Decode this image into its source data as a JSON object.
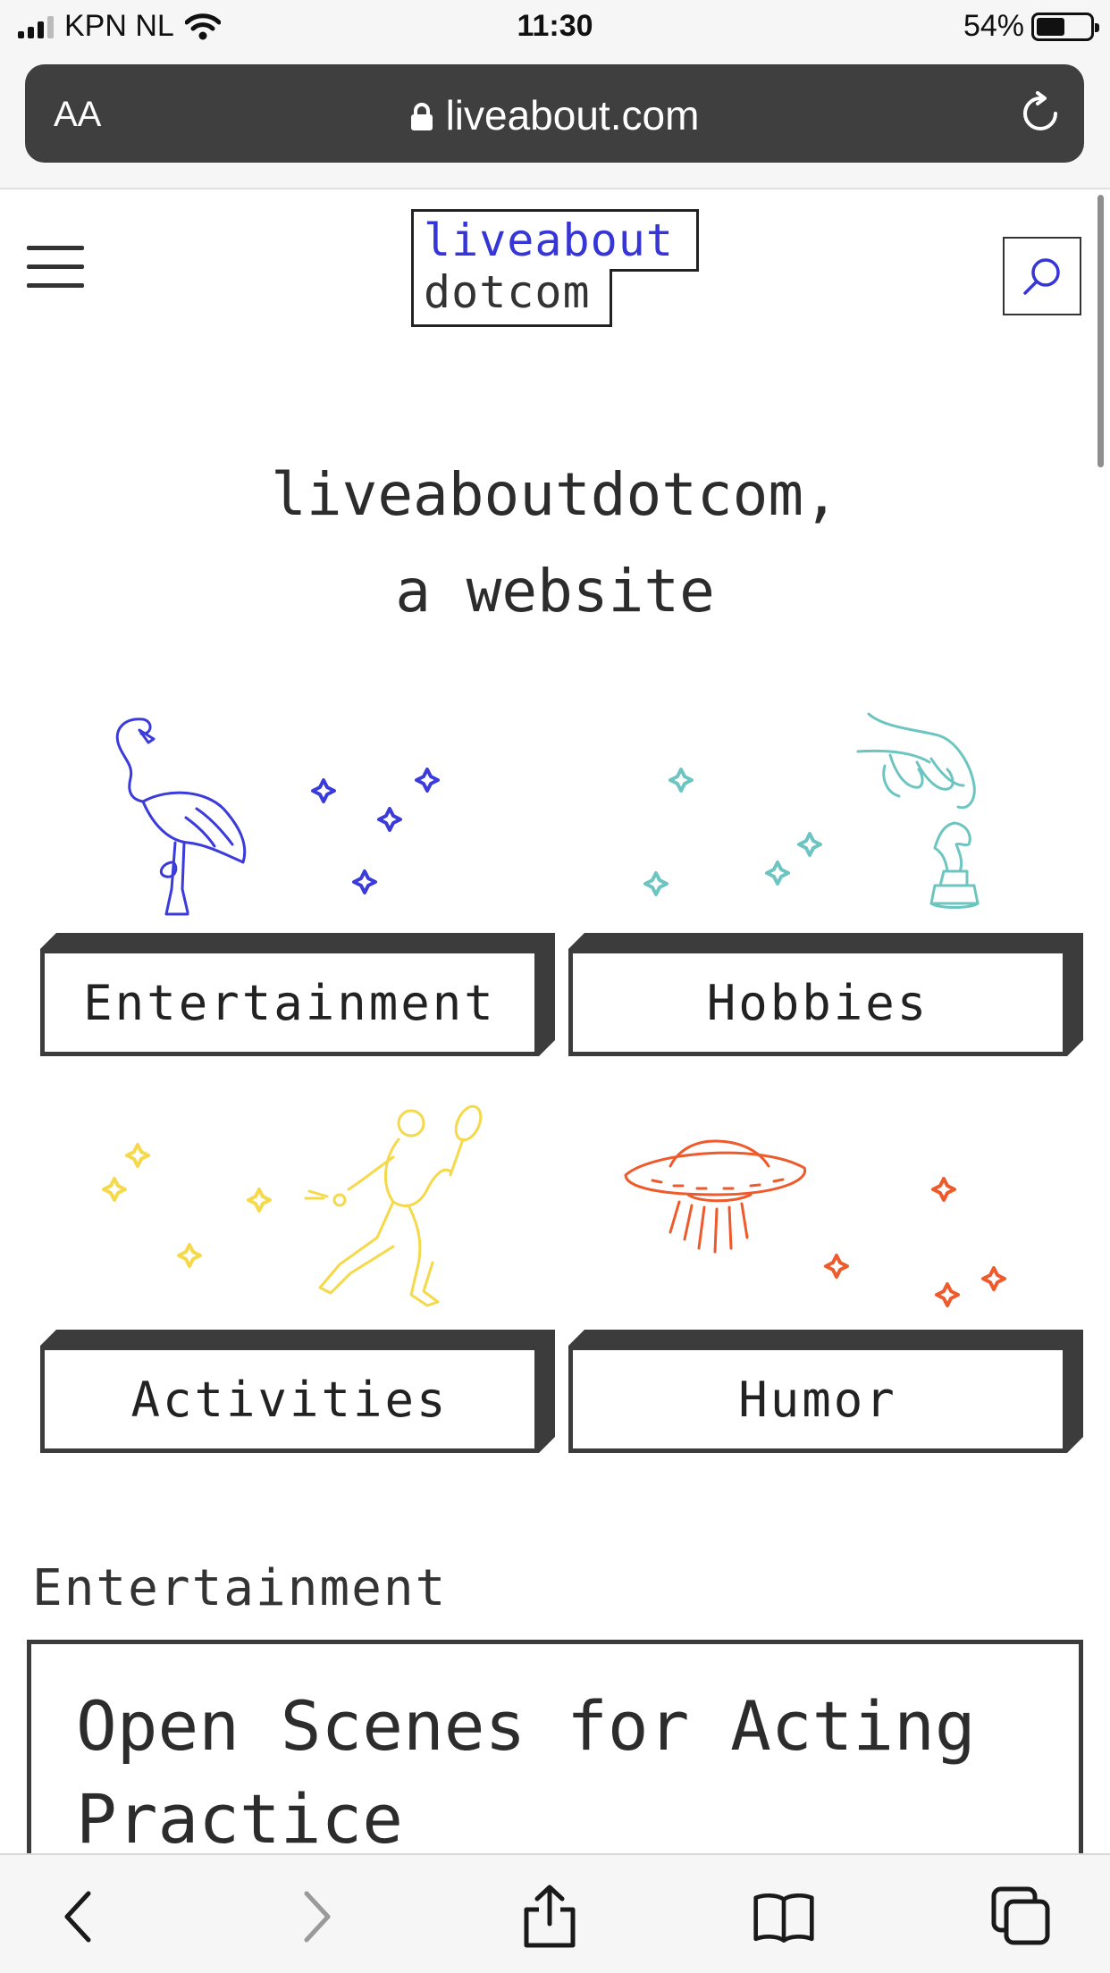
{
  "status_bar": {
    "carrier": "KPN NL",
    "time": "11:30",
    "battery_percent": "54%",
    "battery_level": 0.54
  },
  "browser": {
    "text_size_label": "AA",
    "url": "liveabout.com"
  },
  "site": {
    "logo_line1": "liveabout",
    "logo_line2": "dotcom",
    "accent_color": "#3535d8"
  },
  "hero": {
    "line1": "liveaboutdotcom,",
    "line2": "a website"
  },
  "categories": [
    {
      "label": "Entertainment",
      "illustration": "flamingo-icon",
      "color": "#3b3bdb"
    },
    {
      "label": "Hobbies",
      "illustration": "chess-hand-icon",
      "color": "#6cc5c0"
    },
    {
      "label": "Activities",
      "illustration": "tennis-player-icon",
      "color": "#f5d94a"
    },
    {
      "label": "Humor",
      "illustration": "ufo-icon",
      "color": "#ee5a2c"
    }
  ],
  "section": {
    "title": "Entertainment",
    "card_title": "Open Scenes for Acting Practice"
  }
}
